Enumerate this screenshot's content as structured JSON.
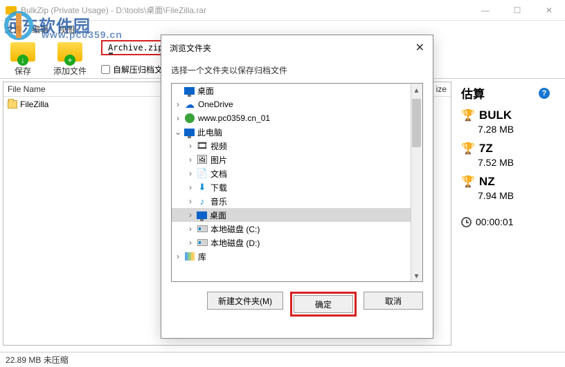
{
  "titlebar": {
    "text": "BulkZip (Private Usage) - D:\\tools\\桌面\\FileZilla.rar"
  },
  "watermark": {
    "text": "河东软件园",
    "url": "www.pc0359.cn"
  },
  "menu": {
    "file": "文件",
    "edit": "编辑",
    "view": "视图"
  },
  "toolbar": {
    "save": "保存",
    "addfile": "添加文件",
    "archivename": "Archive.zip",
    "selfextract": "自解压归档文"
  },
  "filehdr": {
    "name": "File Name",
    "size": "ize"
  },
  "files": {
    "r0": "FileZilla"
  },
  "est": {
    "title": "估算",
    "items": [
      {
        "name": "BULK",
        "size": "7.28 MB"
      },
      {
        "name": "7Z",
        "size": "7.52 MB"
      },
      {
        "name": "NZ",
        "size": "7.94 MB"
      }
    ],
    "time": "00:00:01"
  },
  "status": {
    "text": "22.89 MB 未压缩"
  },
  "dialog": {
    "title": "浏览文件夹",
    "subtitle": "选择一个文件夹以保存归档文件",
    "tree": {
      "desktop": "桌面",
      "onedrive": "OneDrive",
      "user": "www.pc0359.cn_01",
      "thispc": "此电脑",
      "video": "视频",
      "pictures": "图片",
      "documents": "文档",
      "downloads": "下载",
      "music": "音乐",
      "desktop2": "桌面",
      "cdrive": "本地磁盘 (C:)",
      "ddrive": "本地磁盘 (D:)",
      "libraries": "库"
    },
    "btn_new": "新建文件夹(M)",
    "btn_ok": "确定",
    "btn_cancel": "取消"
  }
}
